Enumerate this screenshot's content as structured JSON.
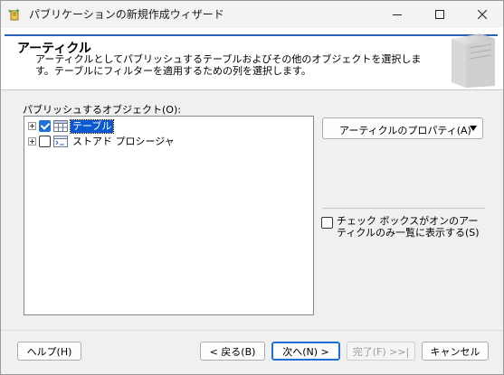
{
  "window": {
    "title": "パブリケーションの新規作成ウィザード"
  },
  "header": {
    "title": "アーティクル",
    "description": "アーティクルとしてパブリッシュするテーブルおよびその他のオブジェクトを選択します。テーブルにフィルターを適用するための列を選択します。"
  },
  "objects": {
    "label": "パブリッシュするオブジェクト(O):",
    "tree": [
      {
        "label": "テーブル",
        "checked": true,
        "selected": true,
        "icon": "table-icon"
      },
      {
        "label": "ストアド プロシージャ",
        "checked": false,
        "selected": false,
        "icon": "stored-procedure-icon"
      }
    ]
  },
  "article_properties": {
    "label": "アーティクルのプロパティ(A)"
  },
  "only_checked": {
    "label": "チェック ボックスがオンのアーティクルのみ一覧に表示する(S)",
    "checked": false
  },
  "buttons": {
    "help": "ヘルプ(H)",
    "back": "< 戻る(B)",
    "next": "次へ(N) >",
    "finish": "完了(F) >>|",
    "cancel": "キャンセル"
  },
  "colors": {
    "accent": "#2a62b8",
    "selection": "#0a58d0",
    "checkbox_checked": "#1f6fd6"
  }
}
